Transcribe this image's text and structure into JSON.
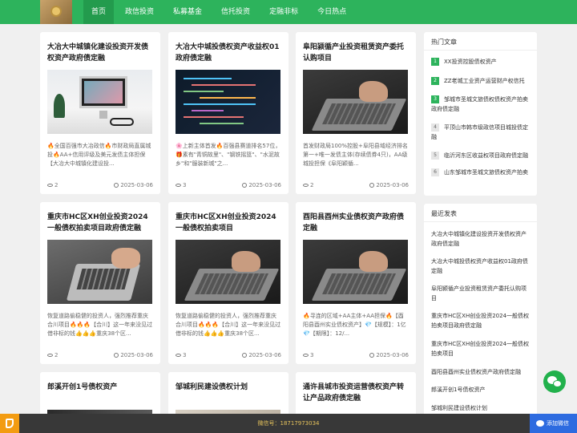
{
  "header": {
    "nav": [
      {
        "label": "首页",
        "active": true
      },
      {
        "label": "政信投资"
      },
      {
        "label": "私募基金"
      },
      {
        "label": "信托投资"
      },
      {
        "label": "定融非标"
      },
      {
        "label": "今日热点"
      }
    ]
  },
  "cards": [
    {
      "title": "大冶大中城镇化建设投资开发债权资产政府债定融",
      "desc": "🔥全国百强市大冶政信🔥市财政局直属城投🔥AA+信用评级及美元发债主体担保【大冶大中城镇化建设投...",
      "views": "2",
      "date": "2025-03-06"
    },
    {
      "title": "大冶大中城投债权资产收益权01政府债定融",
      "desc": "🌸上新主体首发🔥百强县赛道排名57位，🎁素有\"青铜故里\"、\"钢铁摇篮\"、\"水泥故乡\"和\"服装新城\"之...",
      "views": "3",
      "date": "2025-03-06"
    },
    {
      "title": "阜阳颍循产业投资租赁资产委托认购项目",
      "desc": "首发财政局100%控股+阜阳县域经济排名第一+唯一发债主体(存续债券4只)，AA级城投担保《阜阳颖循...",
      "views": "2",
      "date": "2025-03-06"
    },
    {
      "title": "重庆市HC区XH创业投资2024一般债权拍卖项目政府债定融",
      "desc": "恢复道路偷稳健的投资人，强烈推荐重庆合川项目🔥🔥🔥【合川】这一年来没见过借非标的钱👍👍👍重庆38个区...",
      "views": "2",
      "date": "2025-03-06"
    },
    {
      "title": "重庆市HC区XH创业投资2024一般债权拍卖项目",
      "desc": "恢复道路偷稳健的投资人，强烈推荐重庆合川项目🔥🔥🔥【合川】这一年来没见过借非标的钱👍👍👍重庆38个区...",
      "views": "3",
      "date": "2025-03-06"
    },
    {
      "title": "酉阳县酉州实业债权资产政府债定融",
      "desc": "🔥寻连的区域+AA主体+AA担保🔥【酉阳县酉州实业债权资产】💎【规模】：1亿 💎【期限】：12/...",
      "views": "3",
      "date": "2025-03-06"
    },
    {
      "title": "郎溪开创1号债权资产"
    },
    {
      "title": "邹城利民建设债权计划"
    },
    {
      "title": "通许县城市投资运营债权资产转让产品政府债定融"
    }
  ],
  "hot": {
    "title": "热门文章",
    "items": [
      {
        "rank": "1",
        "text": "XX投资控股债权资产"
      },
      {
        "rank": "2",
        "text": "ZZ老城工业资产运营财产权信托"
      },
      {
        "rank": "3",
        "text": "邹城市圣城文旅债权债权资产拍卖政府债定融"
      },
      {
        "rank": "4",
        "text": "平顶山市韩市级政信项目城投债定融"
      },
      {
        "rank": "5",
        "text": "临沂河东区收益权项目政府债定融"
      },
      {
        "rank": "6",
        "text": "山东邹城市圣城文旅债权资产拍卖"
      }
    ]
  },
  "recent": {
    "title": "最近发表",
    "items": [
      "大冶大中城镇化建设投资开发债权资产政府债定融",
      "大冶大中城投债权资产收益权01政府债定融",
      "阜阳颍循产业投资租赁资产委托认购项目",
      "重庆市HC区XH创业投资2024一般债权拍卖项目政府债定融",
      "重庆市HC区XH创业投资2024一般债权拍卖项目",
      "酉阳县酉州实业债权资产政府债定融",
      "郎溪开创1号债权资产",
      "邹城利民建设债权计划"
    ]
  },
  "footer": {
    "wechat_id": "微信号：18717973034",
    "wechat_button": "添加微信"
  },
  "colors": {
    "brand": "#2db35c",
    "footer": "#383838",
    "phone": "#f39c12",
    "wechat_btn": "#2d6be0"
  }
}
